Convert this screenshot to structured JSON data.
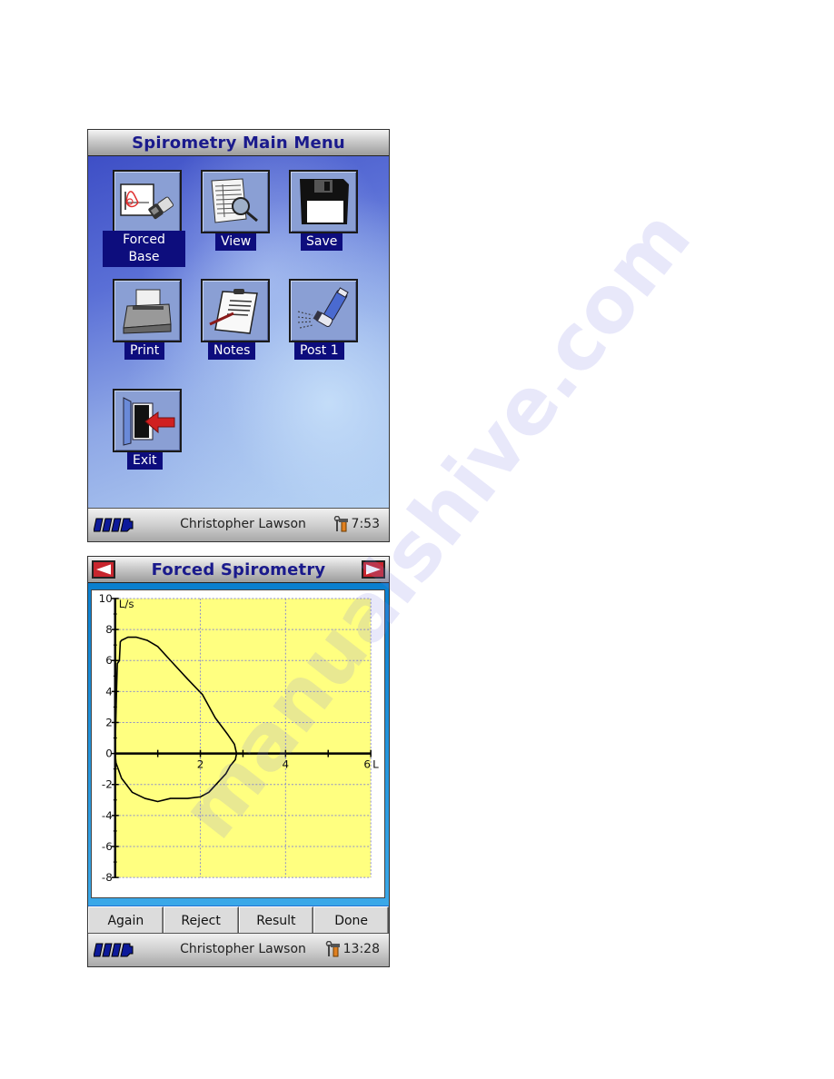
{
  "main_menu": {
    "title": "Spirometry Main Menu",
    "items": [
      {
        "label": "Forced\nBase",
        "line1": "Forced",
        "line2": "Base",
        "icon": "spirometer-flow-icon",
        "selected": true
      },
      {
        "label": "View",
        "icon": "document-magnifier-icon"
      },
      {
        "label": "Save",
        "icon": "floppy-disk-icon"
      },
      {
        "label": "Print",
        "icon": "printer-icon"
      },
      {
        "label": "Notes",
        "icon": "clipboard-pen-icon"
      },
      {
        "label": "Post  1",
        "icon": "inhaler-icon"
      },
      {
        "label": "Exit",
        "icon": "exit-door-icon"
      }
    ],
    "status": {
      "user": "Christopher Lawson",
      "time": "7:53",
      "battery_icon": "battery-icon",
      "settings_icon": "tools-icon"
    }
  },
  "forced_screen": {
    "title": "Forced Spirometry",
    "prev_icon": "left-arrow-icon",
    "next_icon": "right-arrow-icon",
    "buttons": [
      "Again",
      "Reject",
      "Result",
      "Done"
    ],
    "status": {
      "user": "Christopher Lawson",
      "time": "13:28",
      "battery_icon": "battery-icon",
      "settings_icon": "tools-icon"
    }
  },
  "watermark": "manualshive.com",
  "colors": {
    "title_text": "#1a1a8c",
    "label_bg": "#0d0d7d",
    "plot_bg": "#ffff80",
    "grid": "#8c8ccc",
    "nav_arrow": "#c8262e"
  },
  "chart_data": {
    "type": "line",
    "title": "",
    "xlabel": "L",
    "ylabel": "L/s",
    "xlim": [
      0,
      6
    ],
    "ylim": [
      -8,
      10
    ],
    "x_ticks": [
      2,
      4,
      6
    ],
    "x_tick_labels": [
      "2",
      "4",
      "6"
    ],
    "y_ticks": [
      10,
      8,
      6,
      4,
      2,
      0,
      -2,
      -4,
      -6,
      -8
    ],
    "y_tick_labels": [
      "10",
      "8",
      "6",
      "4",
      "2",
      "0",
      "-2",
      "-4",
      "-6",
      "-8"
    ],
    "grid": true,
    "series": [
      {
        "name": "flow-volume loop",
        "x": [
          0.0,
          0.03,
          0.05,
          0.1,
          0.12,
          0.15,
          0.3,
          0.5,
          0.75,
          1.0,
          1.3,
          1.7,
          2.05,
          2.35,
          2.65,
          2.8,
          2.85,
          2.82,
          2.7,
          2.6,
          2.4,
          2.2,
          2.0,
          1.7,
          1.3,
          1.0,
          0.7,
          0.4,
          0.15,
          0.02,
          0.0
        ],
        "y": [
          0.3,
          3.8,
          5.8,
          6.0,
          7.2,
          7.3,
          7.5,
          7.5,
          7.3,
          6.9,
          6.0,
          4.8,
          3.8,
          2.3,
          1.2,
          0.6,
          0.0,
          -0.4,
          -0.8,
          -1.3,
          -1.9,
          -2.5,
          -2.8,
          -2.9,
          -2.9,
          -3.1,
          -2.9,
          -2.5,
          -1.6,
          -0.6,
          0.0
        ]
      }
    ]
  }
}
